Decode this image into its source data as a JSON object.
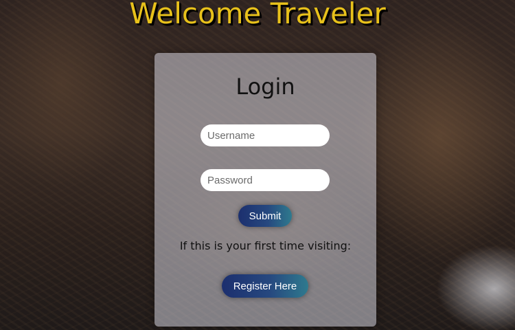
{
  "header": {
    "title": "Welcome Traveler"
  },
  "login": {
    "title": "Login",
    "username_placeholder": "Username",
    "password_placeholder": "Password",
    "submit_label": "Submit",
    "first_time_text": "If this is your first time visiting:",
    "register_label": "Register Here"
  },
  "colors": {
    "title": "#e8c11b",
    "button_gradient_start": "#1c2f6e",
    "button_gradient_end": "#2f7a8e"
  }
}
